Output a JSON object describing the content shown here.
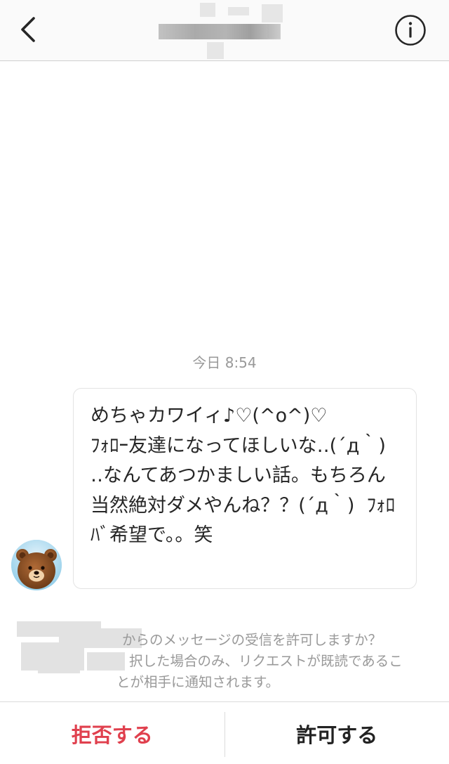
{
  "header": {
    "back_icon": "chevron-left-icon",
    "info_icon": "info-circle-icon"
  },
  "conversation": {
    "timestamp": "今日 8:54",
    "message": {
      "avatar_icon": "brown-bear-avatar",
      "text": "めちゃカワイィ♪♡(^o^)♡\nﾌｫﾛｰ友達になってほしいな‥(´д｀)  ‥なんてあつかましい話。もちろん当然絶対ダメやんね？？(´д｀)  ﾌｫﾛﾊﾞ希望で。。笑"
    }
  },
  "request": {
    "line1": "からのメッセージの受信を許可しますか？",
    "line2": "択した場合のみ、リクエストが既読であるこ",
    "line3": "とが相手に通知されます。"
  },
  "actions": {
    "decline_label": "拒否する",
    "accept_label": "許可する"
  },
  "colors": {
    "decline": "#e0404e",
    "meta_text": "#999999"
  }
}
